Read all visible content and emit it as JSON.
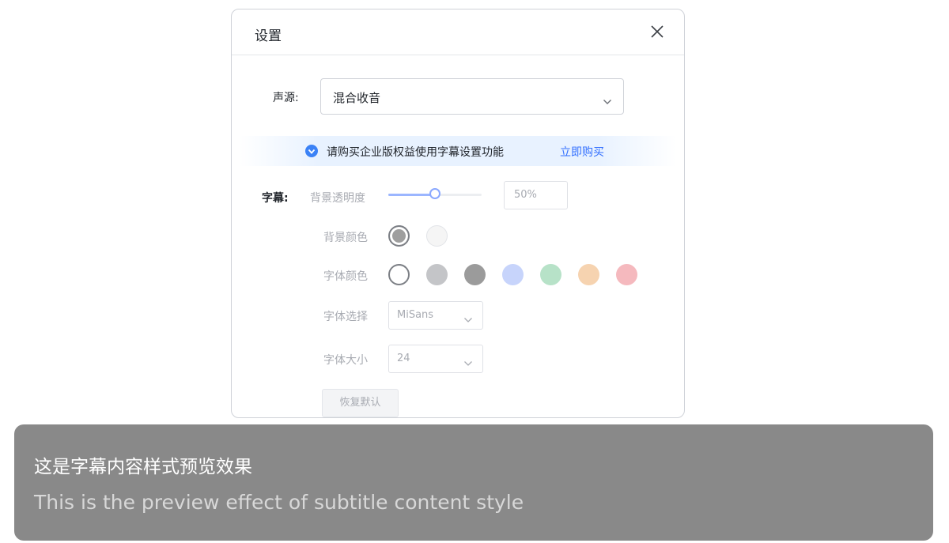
{
  "dialog": {
    "title": "设置",
    "close_icon": "close-icon"
  },
  "source": {
    "label": "声源:",
    "value": "混合收音",
    "icon": "chevron-down-icon"
  },
  "promo": {
    "icon": "diamond-icon",
    "text": "请购买企业版权益使用字幕设置功能",
    "link": "立即购买",
    "accent": "#3370ff"
  },
  "subtitle": {
    "section_label": "字幕:",
    "bg_opacity_label": "背景透明度",
    "bg_opacity_value": "50%",
    "bg_opacity_fraction": 0.5,
    "bg_color_label": "背景颜色",
    "bg_colors": [
      "#9e9e9e",
      "#f5f5f5"
    ],
    "bg_color_selected": 0,
    "font_color_label": "字体颜色",
    "font_colors": [
      "#ffffff",
      "#c4c5c8",
      "#9b9b9b",
      "#c7d4fb",
      "#b7e2c8",
      "#f6d3b0",
      "#f5b9be"
    ],
    "font_color_selected": 0,
    "font_family_label": "字体选择",
    "font_family_value": "MiSans",
    "font_size_label": "字体大小",
    "font_size_value": "24",
    "reset_label": "恢复默认"
  },
  "preview": {
    "line_zh": "这是字幕内容样式预览效果",
    "line_en": "This is the preview effect of subtitle content style",
    "background": "#898989"
  }
}
